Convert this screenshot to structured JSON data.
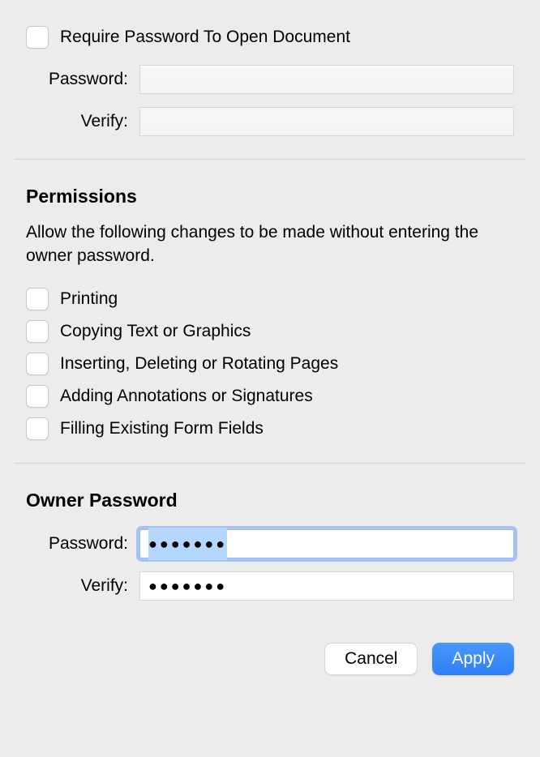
{
  "open_document": {
    "require_password_label": "Require Password To Open Document",
    "password_label": "Password:",
    "verify_label": "Verify:",
    "password_value": "",
    "verify_value": ""
  },
  "permissions": {
    "heading": "Permissions",
    "description": "Allow the following changes to be made without entering the owner password.",
    "items": [
      "Printing",
      "Copying Text or Graphics",
      "Inserting, Deleting or Rotating Pages",
      "Adding Annotations or Signatures",
      "Filling Existing Form Fields"
    ]
  },
  "owner": {
    "heading": "Owner Password",
    "password_label": "Password:",
    "verify_label": "Verify:",
    "password_value": "●●●●●●●",
    "verify_value": "●●●●●●●"
  },
  "buttons": {
    "cancel": "Cancel",
    "apply": "Apply"
  }
}
